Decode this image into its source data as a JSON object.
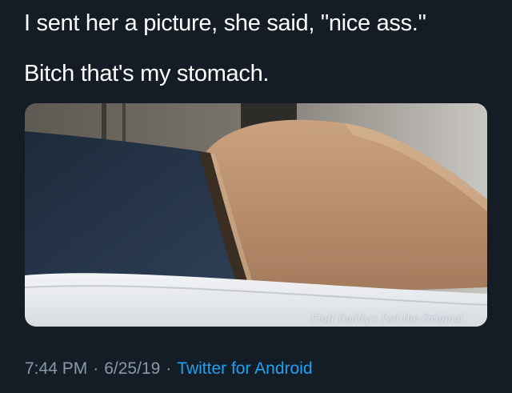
{
  "tweet": {
    "lines": [
      "I sent her a picture, she said, \"nice ass.\"",
      "Bitch that's my stomach."
    ],
    "media": {
      "watermark": "Fluff Daddy's Pad-the Original"
    },
    "meta": {
      "time": "7:44 PM",
      "separator": "·",
      "date": "6/25/19",
      "source": "Twitter for Android"
    }
  },
  "colors": {
    "background": "#141d26",
    "text": "#ffffff",
    "meta_text": "#8899a6",
    "link": "#1da1f2"
  }
}
